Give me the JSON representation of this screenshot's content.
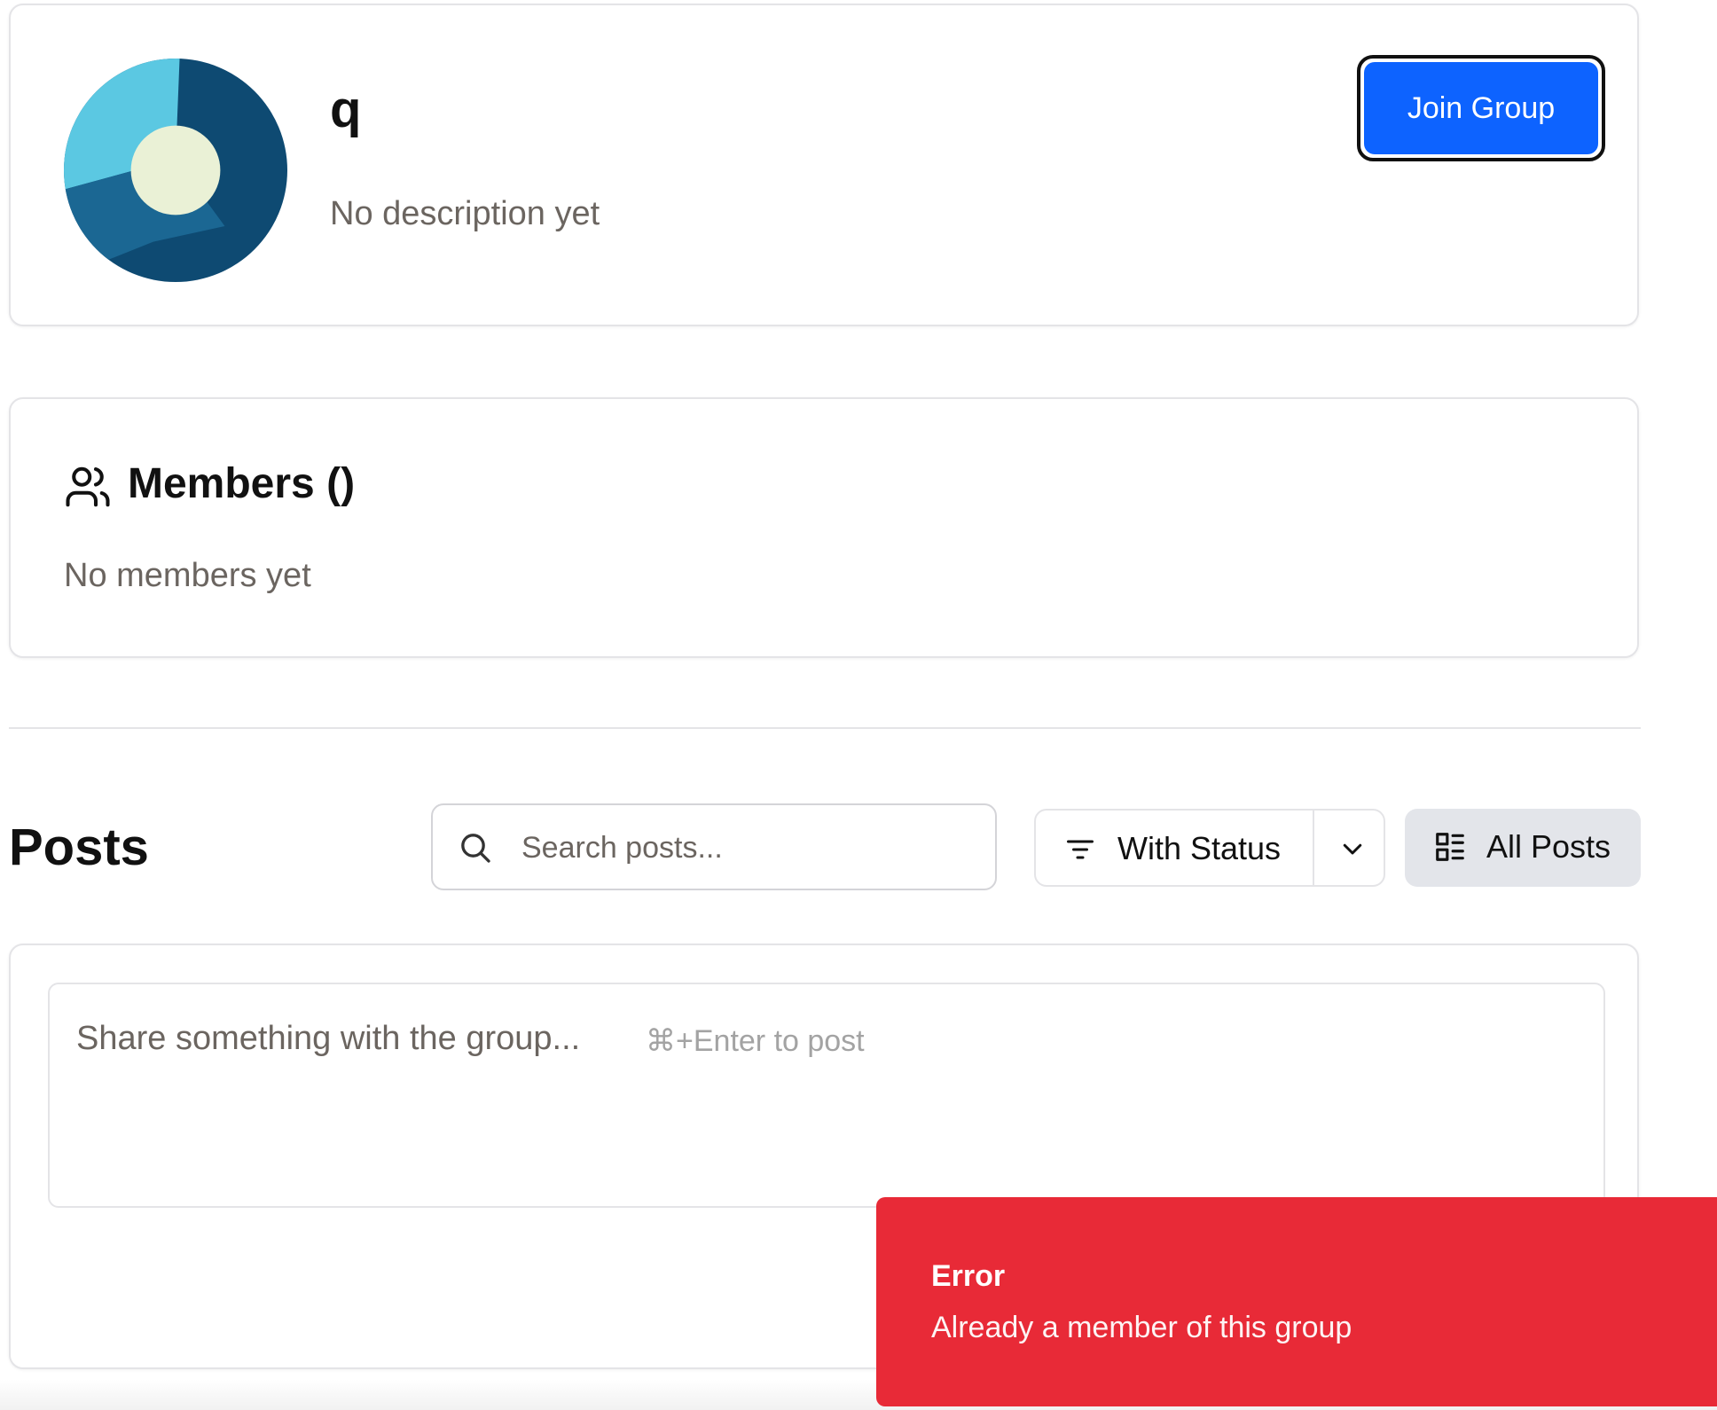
{
  "group": {
    "name": "q",
    "description": "No description yet",
    "join_label": "Join Group",
    "avatar_colors": [
      "#5bc8e2",
      "#0e4a72",
      "#1b6793",
      "#eaf1d6"
    ]
  },
  "members": {
    "title": "Members ()",
    "empty_text": "No members yet"
  },
  "posts": {
    "title": "Posts",
    "search_placeholder": "Search posts...",
    "filter_label": "With Status",
    "view_label": "All Posts",
    "composer_placeholder": "Share something with the group...",
    "composer_hint": "⌘+Enter to post"
  },
  "toast": {
    "title": "Error",
    "message": "Already a member of this group",
    "color": "#e82a37"
  },
  "colors": {
    "accent": "#0d63ff",
    "muted_text": "#6b6560"
  }
}
